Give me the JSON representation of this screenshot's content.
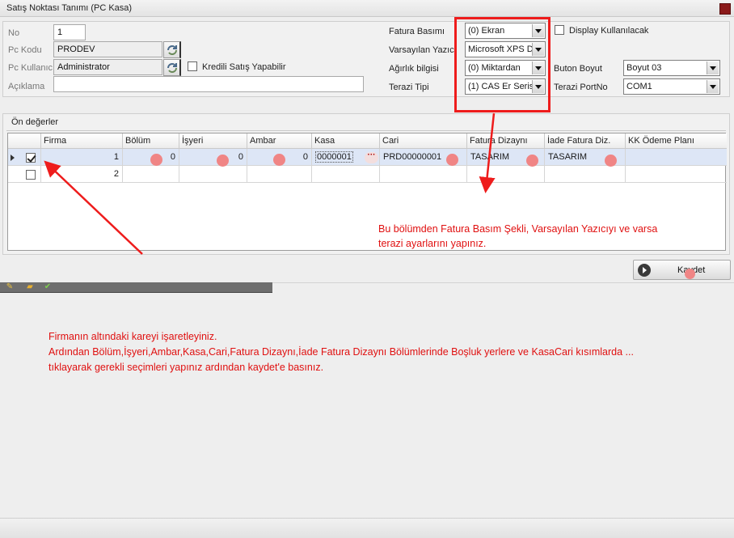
{
  "window": {
    "title": "Satış Noktası Tanımı (PC Kasa)"
  },
  "form": {
    "no": {
      "label": "No",
      "value": "1"
    },
    "pc_kodu": {
      "label": "Pc Kodu",
      "value": "PRODEV"
    },
    "pc_kullanici": {
      "label": "Pc Kullanıcı",
      "value": "Administrator"
    },
    "kredili": {
      "label": "Kredili Satış Yapabilir",
      "checked": false
    },
    "aciklama": {
      "label": "Açıklama",
      "value": ""
    },
    "fatura_basimi": {
      "label": "Fatura Basımı",
      "value": "(0) Ekran"
    },
    "varsayilan_yazici": {
      "label": "Varsayılan Yazıcı",
      "value": "Microsoft XPS Do"
    },
    "agirlik_bilgisi": {
      "label": "Ağırlık bilgisi",
      "value": "(0) Miktardan"
    },
    "terazi_tipi": {
      "label": "Terazi Tipi",
      "value": "(1) CAS Er Serisi"
    },
    "display": {
      "label": "Display Kullanılacak",
      "checked": false
    },
    "buton_boyut": {
      "label": "Buton Boyut",
      "value": "Boyut 03"
    },
    "terazi_portno": {
      "label": "Terazi PortNo",
      "value": "COM1"
    }
  },
  "grid": {
    "title": "Ön değerler",
    "columns": [
      "Firma",
      "Bölüm",
      "İşyeri",
      "Ambar",
      "Kasa",
      "Cari",
      "Fatura Dizaynı",
      "İade Fatura Diz.",
      "KK Ödeme Planı"
    ],
    "rows": [
      {
        "checked": true,
        "firma": "1",
        "bolum": "0",
        "isyeri": "0",
        "ambar": "0",
        "kasa": "0000001",
        "cari": "PRD00000001",
        "fatura_dizayni": "TASARIM",
        "iade_fatura": "TASARIM",
        "kk_odeme": ""
      },
      {
        "checked": false,
        "firma": "2",
        "bolum": "",
        "isyeri": "",
        "ambar": "",
        "kasa": "",
        "cari": "",
        "fatura_dizayni": "",
        "iade_fatura": "",
        "kk_odeme": ""
      }
    ],
    "ellipsis": "···"
  },
  "annotations": {
    "right_line1": "Bu bölümden Fatura Basım Şekli, Varsayılan Yazıcıyı ve varsa",
    "right_line2": "terazi ayarlarını yapınız.",
    "bottom_line1": "Firmanın altındaki kareyi işaretleyiniz.",
    "bottom_line2": "Ardından Bölüm,İşyeri,Ambar,Kasa,Cari,Fatura Dizaynı,İade Fatura Dizaynı Bölümlerinde Boşluk yerlere ve KasaCari kısımlarda ...",
    "bottom_line3": "tıklayarak gerekli seçimleri yapınız ardından kaydet'e basınız.",
    "color": "#e01010"
  },
  "buttons": {
    "save": "Kaydet"
  },
  "icons": [
    "refresh-pick-icon",
    "play-circle-icon",
    "pencil-icon",
    "folder-icon",
    "check-icon"
  ]
}
